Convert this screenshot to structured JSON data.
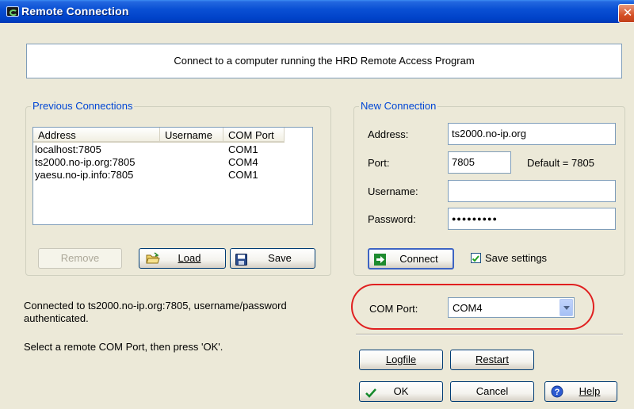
{
  "window": {
    "title": "Remote Connection",
    "close_glyph": "✕"
  },
  "header": {
    "text": "Connect to a computer running the HRD Remote Access Program"
  },
  "previous_connections": {
    "legend": "Previous Connections",
    "columns": [
      "Address",
      "Username",
      "COM Port"
    ],
    "rows": [
      {
        "address": "localhost:7805",
        "username": "",
        "com_port": "COM1"
      },
      {
        "address": "ts2000.no-ip.org:7805",
        "username": "",
        "com_port": "COM4"
      },
      {
        "address": "yaesu.no-ip.info:7805",
        "username": "",
        "com_port": "COM1"
      }
    ],
    "buttons": {
      "remove": {
        "label": "Remove",
        "enabled": false
      },
      "load": {
        "label": "Load",
        "icon": "open-folder-icon"
      },
      "save": {
        "label": "Save",
        "icon": "floppy-disk-icon"
      }
    }
  },
  "new_connection": {
    "legend": "New Connection",
    "address": {
      "label": "Address:",
      "value": "ts2000.no-ip.org"
    },
    "port": {
      "label": "Port:",
      "value": "7805",
      "default_note": "Default = 7805"
    },
    "username": {
      "label": "Username:",
      "value": ""
    },
    "password": {
      "label": "Password:",
      "value": "●●●●●●●●●"
    },
    "connect_button": {
      "label": "Connect",
      "icon": "green-arrow-icon"
    },
    "save_settings": {
      "label": "Save settings",
      "checked": true
    }
  },
  "status": {
    "line1": "Connected to ts2000.no-ip.org:7805, username/password",
    "line2": "authenticated.",
    "instruction": "Select a remote COM Port, then press 'OK'."
  },
  "com_port": {
    "label": "COM Port:",
    "value": "COM4"
  },
  "footer_buttons": {
    "logfile": "Logfile",
    "restart": "Restart",
    "ok": {
      "label": "OK",
      "icon": "checkmark-icon"
    },
    "cancel": "Cancel",
    "help": {
      "label": "Help",
      "icon": "help-icon"
    }
  },
  "colors": {
    "title_bar": "#0A50D4",
    "legend_text": "#0046D5",
    "highlight": "#E02020",
    "dialog_bg": "#ECE9D8"
  }
}
